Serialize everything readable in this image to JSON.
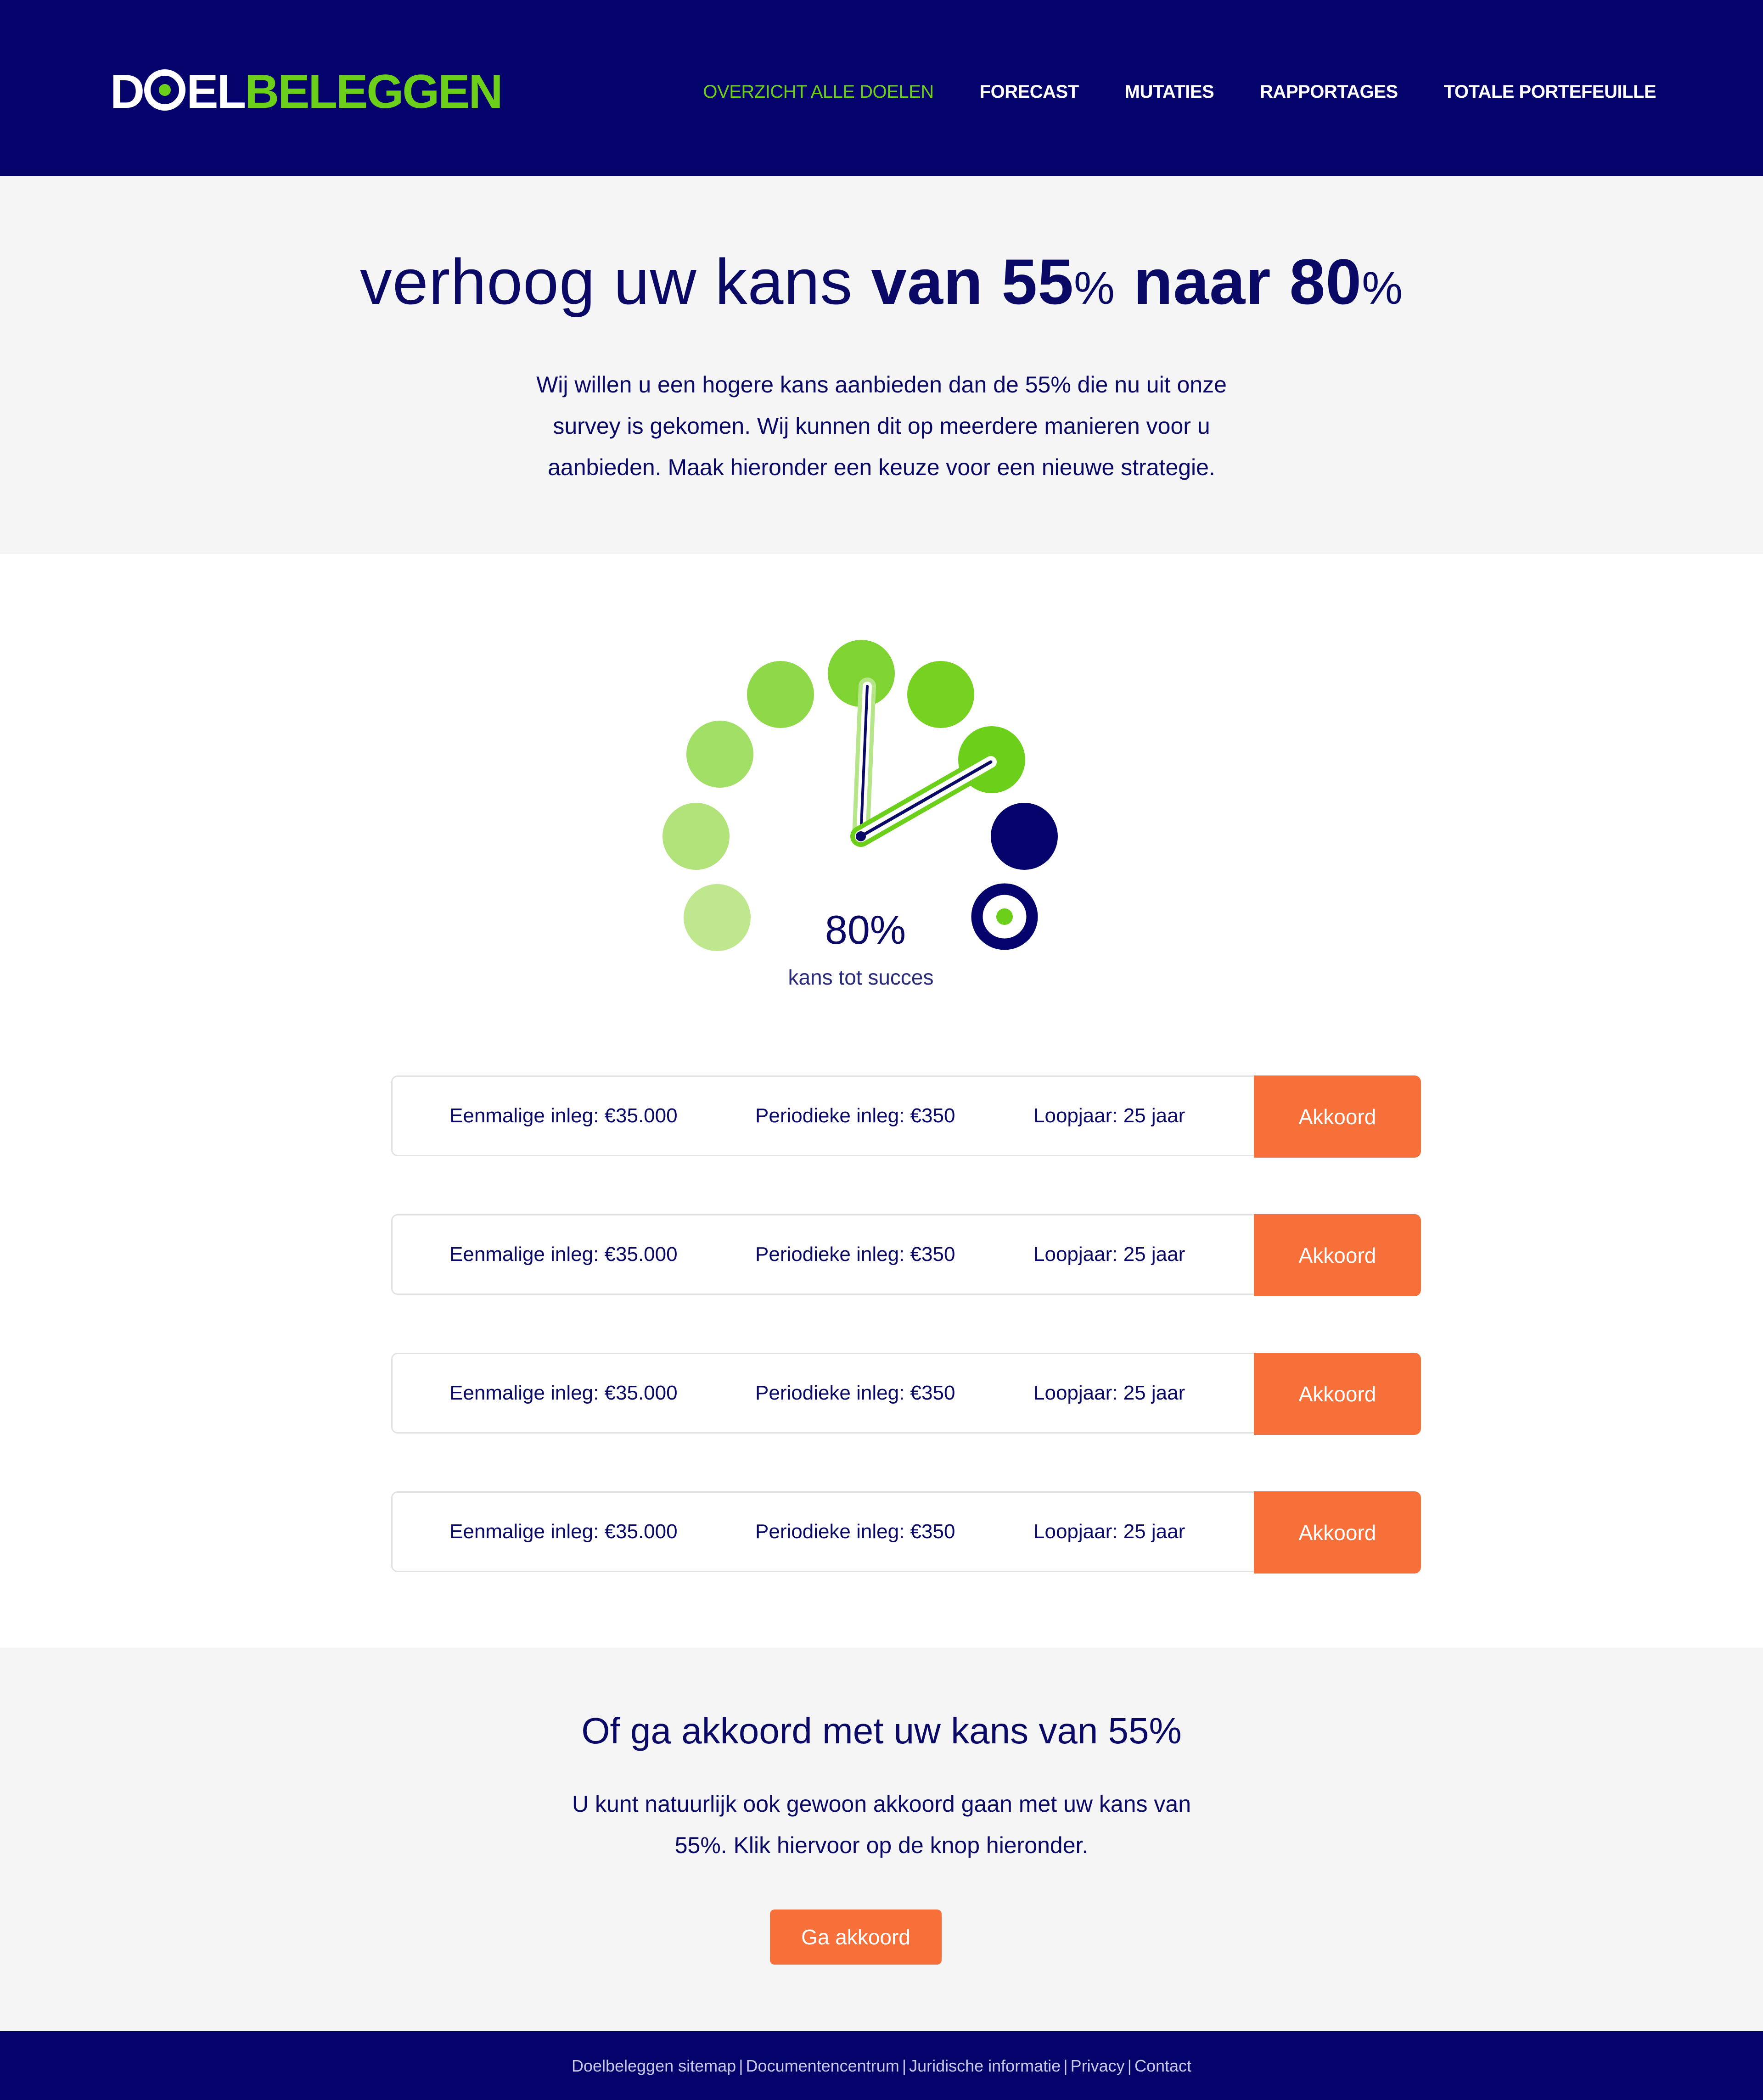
{
  "brand": {
    "part1": "D",
    "part2": "EL",
    "part3": "BELEGGEN",
    "color_primary": "#03036b",
    "color_accent": "#6ccf1a",
    "color_cta": "#f7703a"
  },
  "nav": {
    "items": [
      {
        "label": "OVERZICHT ALLE DOELEN",
        "active": true
      },
      {
        "label": "FORECAST"
      },
      {
        "label": "MUTATIES"
      },
      {
        "label": "RAPPORTAGES"
      },
      {
        "label": "TOTALE PORTEFEUILLE"
      }
    ]
  },
  "intro": {
    "title_start": "verhoog uw kans ",
    "title_bold_1": "van 55",
    "title_pct_1": "%",
    "title_bold_2": " naar 80",
    "title_pct_2": "%",
    "text": "Wij willen u een hogere kans aanbieden dan de 55% die nu uit onze survey is gekomen. Wij kunnen dit op meerdere manieren voor u aanbieden. Maak hieronder een keuze voor een nieuwe strategie."
  },
  "gauge": {
    "value": "80%",
    "label": "kans tot succes",
    "current_percent": 55,
    "target_percent": 80
  },
  "options": [
    {
      "eenmalig": "Eenmalige inleg: €35.000",
      "periodiek": "Periodieke inleg: €350",
      "loopjaar": "Loopjaar: 25 jaar",
      "button": "Akkoord"
    },
    {
      "eenmalig": "Eenmalige inleg: €35.000",
      "periodiek": "Periodieke inleg: €350",
      "loopjaar": "Loopjaar: 25 jaar",
      "button": "Akkoord"
    },
    {
      "eenmalig": "Eenmalige inleg: €35.000",
      "periodiek": "Periodieke inleg: €350",
      "loopjaar": "Loopjaar: 25 jaar",
      "button": "Akkoord"
    },
    {
      "eenmalig": "Eenmalige inleg: €35.000",
      "periodiek": "Periodieke inleg: €350",
      "loopjaar": "Loopjaar: 25 jaar",
      "button": "Akkoord"
    }
  ],
  "accept": {
    "title": "Of ga akkoord met uw kans van 55%",
    "text": "U kunt natuurlijk ook gewoon akkoord gaan met uw kans van 55%. Klik hiervoor op de knop hieronder.",
    "button": "Ga akkoord"
  },
  "footer": {
    "links": [
      "Doelbeleggen sitemap",
      "Documentencentrum",
      "Juridische informatie",
      "Privacy",
      "Contact"
    ],
    "separator": "|"
  }
}
